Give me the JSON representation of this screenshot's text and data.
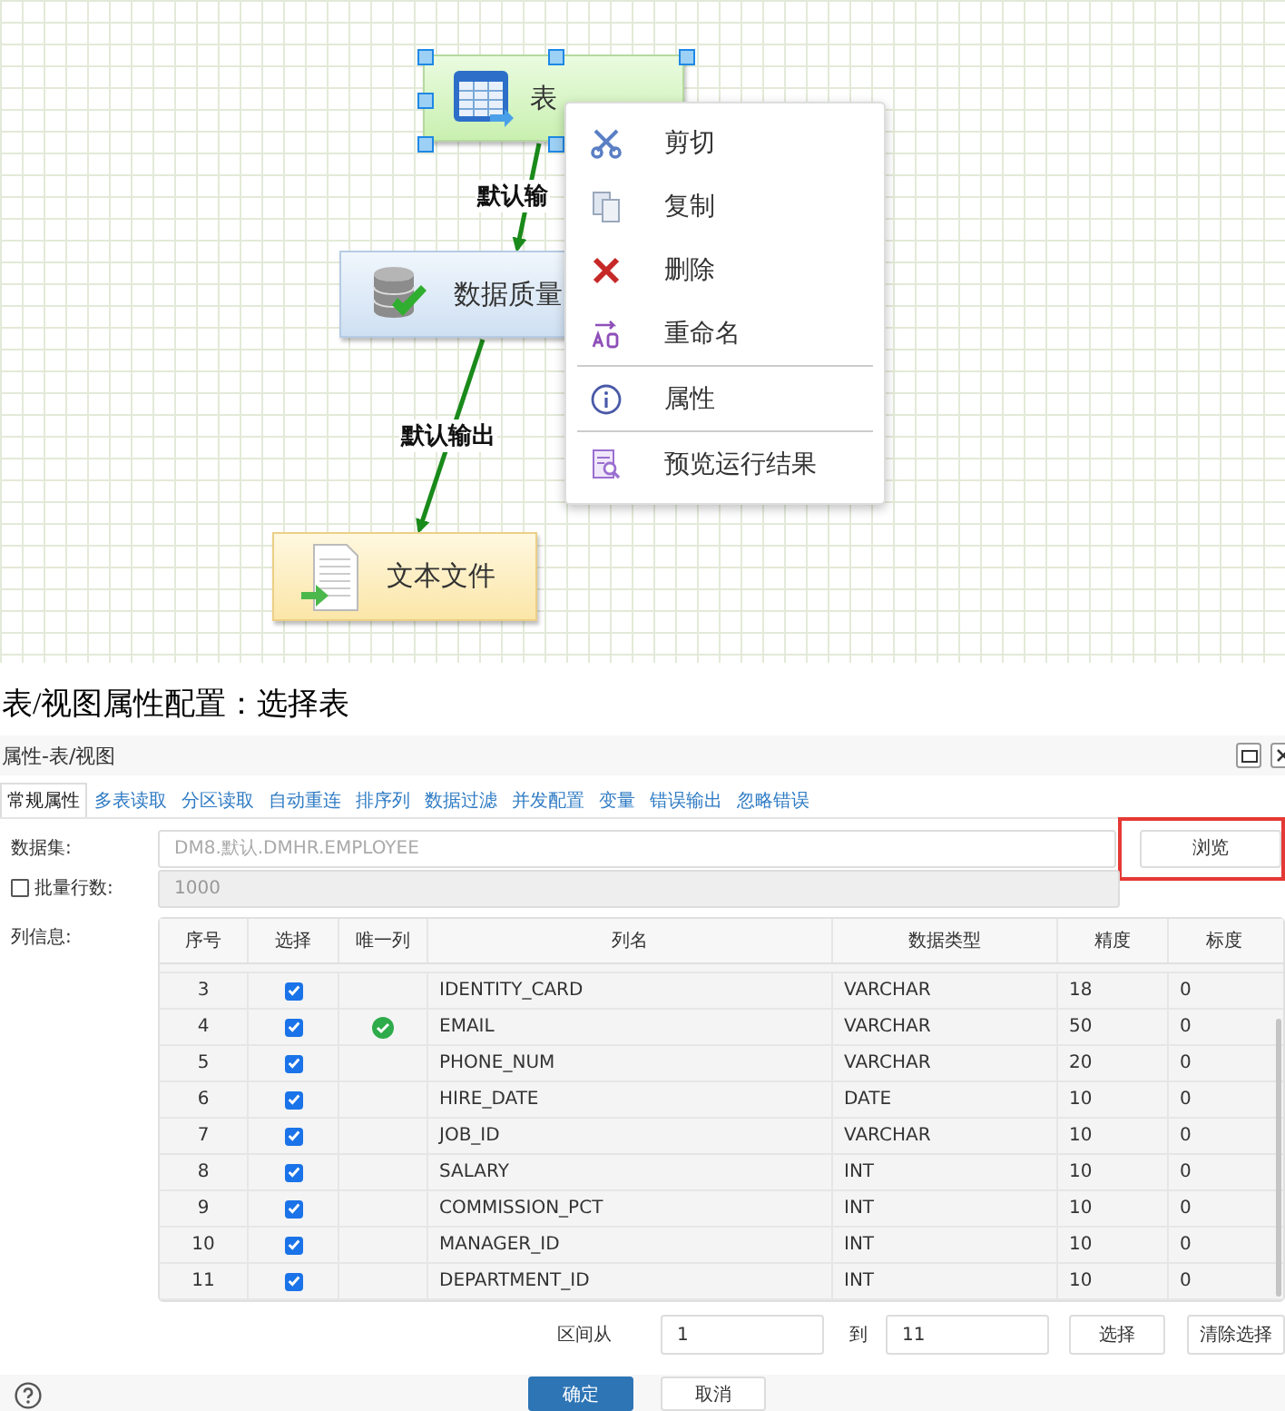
{
  "diagram": {
    "nodes": [
      {
        "kind": "table",
        "label": "表",
        "selected": true
      },
      {
        "kind": "quality",
        "label": "数据质量",
        "selected": false
      },
      {
        "kind": "file",
        "label": "文本文件",
        "selected": false
      }
    ],
    "edges": [
      {
        "label": "默认输"
      },
      {
        "label": "默认输出"
      }
    ],
    "context_menu": [
      {
        "kind": "cut",
        "label": "剪切",
        "separator_after": false
      },
      {
        "kind": "copy",
        "label": "复制",
        "separator_after": false
      },
      {
        "kind": "delete",
        "label": "删除",
        "separator_after": false
      },
      {
        "kind": "rename",
        "label": "重命名",
        "separator_after": true
      },
      {
        "kind": "info",
        "label": "属性",
        "separator_after": true
      },
      {
        "kind": "preview",
        "label": "预览运行结果",
        "separator_after": false
      }
    ]
  },
  "caption": "表/视图属性配置：选择表",
  "dialog": {
    "title": "属性-表/视图",
    "tabs": [
      {
        "label": "常规属性",
        "selected": true
      },
      {
        "label": "多表读取",
        "selected": false
      },
      {
        "label": "分区读取",
        "selected": false
      },
      {
        "label": "自动重连",
        "selected": false
      },
      {
        "label": "排序列",
        "selected": false
      },
      {
        "label": "数据过滤",
        "selected": false
      },
      {
        "label": "并发配置",
        "selected": false
      },
      {
        "label": "变量",
        "selected": false
      },
      {
        "label": "错误输出",
        "selected": false
      },
      {
        "label": "忽略错误",
        "selected": false
      }
    ],
    "dataset": {
      "label": "数据集:",
      "placeholder": "DM8.默认.DMHR.EMPLOYEE",
      "button": "浏览",
      "highlighted": true
    },
    "batch": {
      "label": "批量行数:",
      "checked": false,
      "value": "1000"
    },
    "columns_label": "列信息:",
    "table": {
      "columns": [
        "序号",
        "选择",
        "唯一列",
        "列名",
        "数据类型",
        "精度",
        "标度"
      ],
      "rows": [
        {
          "no": "3",
          "checked": true,
          "unique": false,
          "name": "IDENTITY_CARD",
          "type": "VARCHAR",
          "precision": "18",
          "scale": "0"
        },
        {
          "no": "4",
          "checked": true,
          "unique": true,
          "name": "EMAIL",
          "type": "VARCHAR",
          "precision": "50",
          "scale": "0"
        },
        {
          "no": "5",
          "checked": true,
          "unique": false,
          "name": "PHONE_NUM",
          "type": "VARCHAR",
          "precision": "20",
          "scale": "0"
        },
        {
          "no": "6",
          "checked": true,
          "unique": false,
          "name": "HIRE_DATE",
          "type": "DATE",
          "precision": "10",
          "scale": "0"
        },
        {
          "no": "7",
          "checked": true,
          "unique": false,
          "name": "JOB_ID",
          "type": "VARCHAR",
          "precision": "10",
          "scale": "0"
        },
        {
          "no": "8",
          "checked": true,
          "unique": false,
          "name": "SALARY",
          "type": "INT",
          "precision": "10",
          "scale": "0"
        },
        {
          "no": "9",
          "checked": true,
          "unique": false,
          "name": "COMMISSION_PCT",
          "type": "INT",
          "precision": "10",
          "scale": "0"
        },
        {
          "no": "10",
          "checked": true,
          "unique": false,
          "name": "MANAGER_ID",
          "type": "INT",
          "precision": "10",
          "scale": "0"
        },
        {
          "no": "11",
          "checked": true,
          "unique": false,
          "name": "DEPARTMENT_ID",
          "type": "INT",
          "precision": "10",
          "scale": "0"
        }
      ]
    },
    "range": {
      "from_label": "区间从",
      "from": "1",
      "to_label": "到",
      "to": "11",
      "select": "选择",
      "clear": "清除选择"
    },
    "buttons": [
      {
        "kind": "primary",
        "label": "确定"
      },
      {
        "kind": "default",
        "label": "取消"
      }
    ]
  }
}
